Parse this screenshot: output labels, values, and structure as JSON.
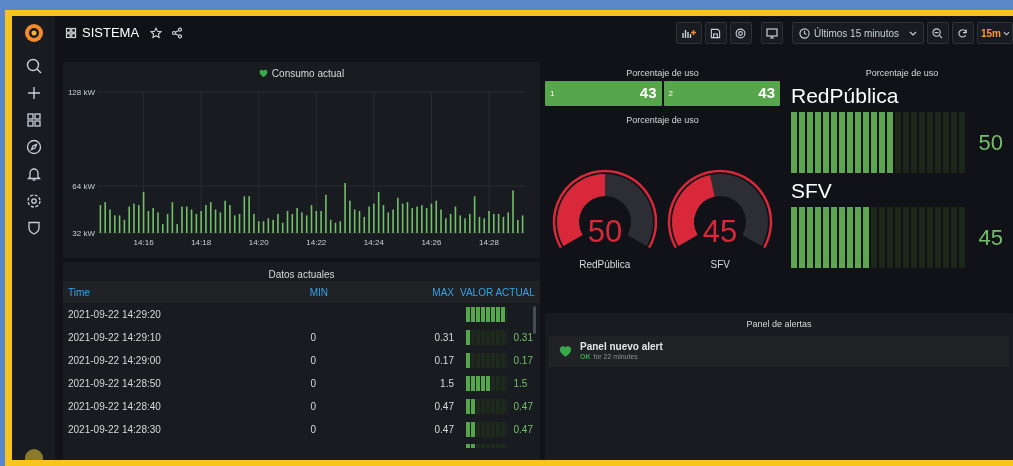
{
  "top_bar": {
    "title": "SISTEMA",
    "time_range": "Últimos 15 minutos",
    "refresh_interval": "15m"
  },
  "consumption_panel": {
    "chart_data": {
      "type": "bar",
      "grid": true,
      "ylim": [
        32,
        128
      ],
      "yticks": [
        {
          "value": 32,
          "label": "32 kW"
        },
        {
          "value": 64,
          "label": "64 kW"
        },
        {
          "value": 128,
          "label": "128 kW"
        }
      ],
      "categories": [
        null,
        null,
        null,
        null,
        null,
        null,
        null,
        null,
        null,
        "14:16",
        null,
        null,
        null,
        null,
        null,
        null,
        null,
        null,
        null,
        null,
        null,
        "14:18",
        null,
        null,
        null,
        null,
        null,
        null,
        null,
        null,
        null,
        null,
        null,
        "14:20",
        null,
        null,
        null,
        null,
        null,
        null,
        null,
        null,
        null,
        null,
        null,
        "14:22",
        null,
        null,
        null,
        null,
        null,
        null,
        null,
        null,
        null,
        null,
        null,
        "14:24",
        null,
        null,
        null,
        null,
        null,
        null,
        null,
        null,
        null,
        null,
        null,
        "14:26",
        null,
        null,
        null,
        null,
        null,
        null,
        null,
        null,
        null,
        null,
        null,
        "14:28",
        null,
        null,
        null,
        null,
        null,
        null,
        null
      ],
      "series": [
        {
          "name": "Consumo actual",
          "color": "#73bf69",
          "values": [
            51,
            53,
            48,
            44,
            44,
            41,
            50,
            52,
            51,
            60,
            47,
            49,
            46,
            38,
            45,
            53,
            38,
            50,
            50,
            48,
            45,
            47,
            51,
            53,
            48,
            46,
            54,
            51,
            44,
            45,
            57,
            57,
            45,
            40,
            40,
            42,
            41,
            45,
            39,
            47,
            45,
            49,
            46,
            44,
            51,
            47,
            47,
            58,
            41,
            39,
            40,
            66,
            54,
            48,
            47,
            43,
            50,
            52,
            60,
            51,
            46,
            48,
            56,
            52,
            53,
            49,
            50,
            51,
            49,
            52,
            54,
            48,
            42,
            45,
            50,
            44,
            42,
            45,
            57,
            43,
            42,
            47,
            45,
            45,
            43,
            46,
            61,
            41,
            44
          ]
        }
      ]
    }
  },
  "table_panel": {
    "title": "Datos actuales",
    "columns": [
      "Time",
      "MIN",
      "MAX",
      "VALOR ACTUAL"
    ],
    "rows": [
      {
        "time": "2021-09-22 14:29:20",
        "level": 1
      },
      {
        "time": "2021-09-22 14:29:10",
        "min": "0",
        "max": "0.31",
        "level": 0.125,
        "value": "0.31"
      },
      {
        "time": "2021-09-22 14:29:00",
        "min": "0",
        "max": "0.17",
        "level": 0.125,
        "value": "0.17"
      },
      {
        "time": "2021-09-22 14:28:50",
        "min": "0",
        "max": "1.5",
        "level": 0.625,
        "value": "1.5"
      },
      {
        "time": "2021-09-22 14:28:40",
        "min": "0",
        "max": "0.47",
        "level": 0.25,
        "value": "0.47"
      },
      {
        "time": "2021-09-22 14:28:30",
        "min": "0",
        "max": "0.47",
        "level": 0.25,
        "value": "0.47"
      },
      {
        "level": 0.25
      }
    ]
  },
  "stat_panel": {
    "title": "Porcentaje de uso",
    "items": [
      {
        "label": "1",
        "value": "43"
      },
      {
        "label": "2",
        "value": "43"
      }
    ]
  },
  "gauge_panel": {
    "title": "Porcentaje de uso",
    "gauges": [
      {
        "label": "RedPública",
        "value": "50",
        "level": 0.5
      },
      {
        "label": "SFV",
        "value": "45",
        "level": 0.45
      }
    ]
  },
  "bar_gauge_panel": {
    "title": "Porcentaje de uso",
    "items": [
      {
        "label": "RedPública",
        "value": "50",
        "level": 0.59
      },
      {
        "label": "SFV",
        "value": "45",
        "level": 0.45
      }
    ]
  },
  "alert_panel": {
    "title": "Panel de alertas",
    "alerts": [
      {
        "name": "Panel nuevo alert",
        "color": "#37a94a",
        "state_label": "OK",
        "duration": "for 22 minutes"
      }
    ]
  }
}
